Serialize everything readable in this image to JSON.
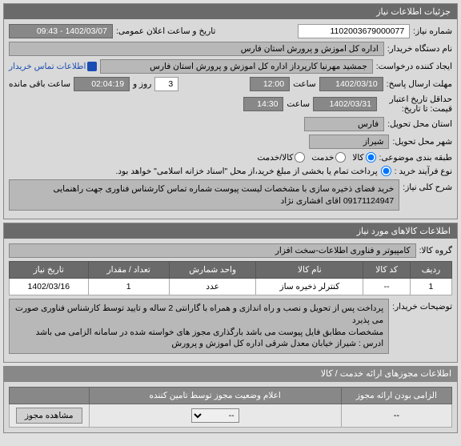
{
  "panel1": {
    "title": "جزئیات اطلاعات نیاز",
    "need_number_label": "شماره نیاز:",
    "need_number": "1102003679000077",
    "announce_label": "تاریخ و ساعت اعلان عمومی:",
    "announce_value": "1402/03/07 - 09:43",
    "buyer_org_label": "نام دستگاه خریدار:",
    "buyer_org": "اداره کل اموزش و پرورش استان فارس",
    "creator_label": "ایجاد کننده درخواست:",
    "creator": "جمشید مهرنیا کارپرداز اداره کل اموزش و پرورش استان فارس",
    "contact_link": "اطلاعات تماس خریدار",
    "response_deadline_label": "مهلت ارسال پاسخ:",
    "deadline_date": "1402/03/10",
    "time_label": "ساعت",
    "deadline_time": "12:00",
    "days_count": "3",
    "day_and_label": "روز و",
    "remaining_time": "02:04:19",
    "remaining_label": "ساعت باقی مانده",
    "credit_to_label": "حداقل تاریخ اعتبار قیمت: تا تاریخ:",
    "credit_date": "1402/03/31",
    "credit_time": "14:30",
    "province_label": "استان محل تحویل:",
    "province": "فارس",
    "city_label": "شهر محل تحویل:",
    "city": "شیراز",
    "category_label": "طبقه بندی موضوعی:",
    "cat_goods": "کالا",
    "cat_service": "خدمت",
    "cat_both": "کالا/خدمت",
    "purchase_type_label": "نوع فرآیند خرید :",
    "purchase_type_note": "پرداخت تمام یا بخشی از مبلغ خرید،از محل \"اسناد خزانه اسلامی\" خواهد بود.",
    "overview_label": "شرح کلی نیاز:",
    "overview_text": "خرید فضای ذخیره سازی با مشخصات لیست پیوست شماره تماس کارشناس فناوری جهت راهنمایی 09171124947 اقای افشاری نژاد"
  },
  "panel2": {
    "title": "اطلاعات کالاهای مورد نیاز",
    "group_label": "گروه کالا:",
    "group_value": "کامپیوتر و فناوری اطلاعات-سخت افزار",
    "table": {
      "headers": [
        "ردیف",
        "کد کالا",
        "نام کالا",
        "واحد شمارش",
        "تعداد / مقدار",
        "تاریخ نیاز"
      ],
      "rows": [
        [
          "1",
          "--",
          "کنترلر ذخیره ساز",
          "عدد",
          "1",
          "1402/03/16"
        ]
      ]
    },
    "buyer_notes_label": "توضیحات خریدار:",
    "buyer_notes_text": "پرداخت پس از تحویل و نصب و راه اندازی و همراه با گارانتی 2 ساله و تایید توسط کارشناس فناوری صورت می پذیرد\nمشخصات مطابق فایل پیوست می باشد بارگذاری مجوز های خواسته شده در سامانه الزامی می باشد\nادرس : شیراز خیابان معدل شرقی اداره کل اموزش و پرورش"
  },
  "panel3": {
    "title": "اطلاعات مجوزهای ارائه خدمت / کالا",
    "col_required": "الزامی بودن ارائه مجوز",
    "col_status": "اعلام وضعیت مجوز توسط تامین کننده",
    "required_value": "--",
    "status_placeholder": "--",
    "view_btn": "مشاهده مجوز"
  }
}
